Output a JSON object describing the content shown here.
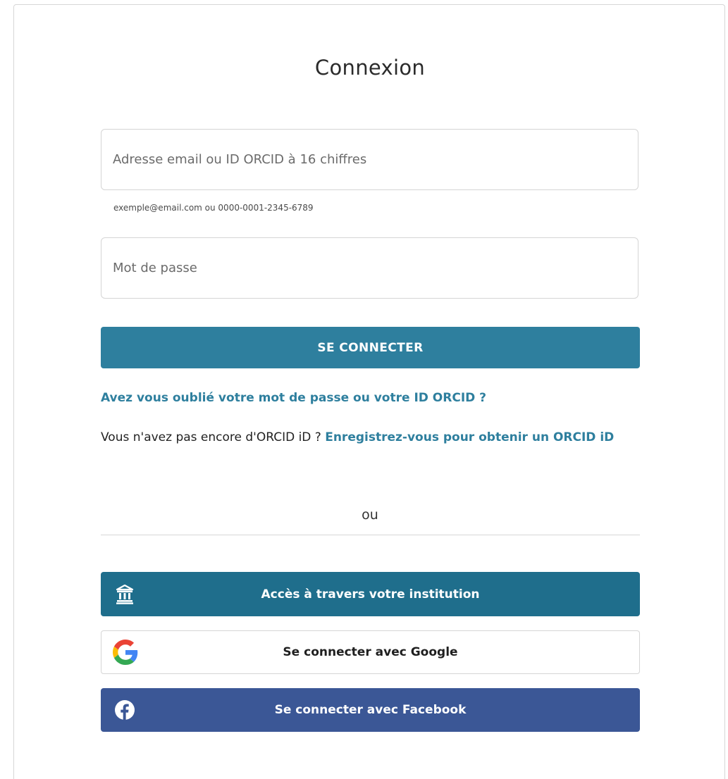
{
  "page": {
    "title": "Connexion"
  },
  "form": {
    "email_placeholder": "Adresse email ou ID ORCID à 16 chiffres",
    "email_value": "",
    "email_hint": "exemple@email.com ou 0000-0001-2345-6789",
    "password_placeholder": "Mot de passe",
    "password_value": "",
    "signin_label": "SE CONNECTER"
  },
  "links": {
    "forgot": "Avez vous oublié votre mot de passe ou votre ID ORCID ?",
    "register_prompt": "Vous n'avez pas encore d'ORCID iD ? ",
    "register_link": "Enregistrez-vous pour obtenir un ORCID iD"
  },
  "alternate": {
    "or_label": "ou",
    "institution_label": "Accès à travers votre institution",
    "institution_icon": "institution-icon",
    "google_label": "Se connecter avec Google",
    "google_icon": "google-logo-icon",
    "facebook_label": "Se connecter avec Facebook",
    "facebook_icon": "facebook-logo-icon"
  },
  "colors": {
    "primary": "#2e7f9e",
    "institution": "#1f6e8c",
    "facebook": "#3b5796"
  }
}
